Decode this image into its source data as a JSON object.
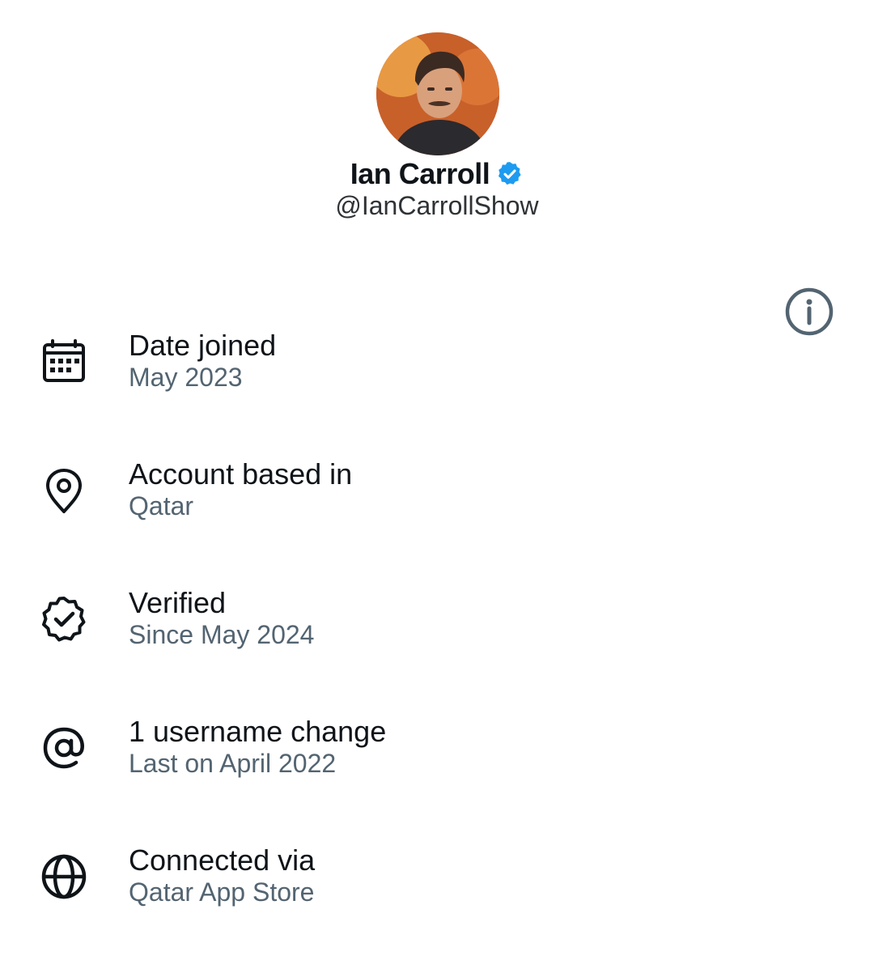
{
  "profile": {
    "display_name": "Ian Carroll",
    "handle": "@IanCarrollShow",
    "verified": true,
    "badge_color": "#1d9bf0"
  },
  "about": {
    "items": [
      {
        "icon": "calendar-icon",
        "title": "Date joined",
        "subtitle": "May 2023"
      },
      {
        "icon": "location-pin-icon",
        "title": "Account based in",
        "subtitle": "Qatar"
      },
      {
        "icon": "verified-badge-outline-icon",
        "title": "Verified",
        "subtitle": "Since May 2024",
        "has_info_button": true
      },
      {
        "icon": "at-sign-icon",
        "title": "1 username change",
        "subtitle": "Last on April 2022"
      },
      {
        "icon": "globe-icon",
        "title": "Connected via",
        "subtitle": "Qatar App Store"
      }
    ]
  },
  "colors": {
    "primary_text": "#0f1419",
    "secondary_text": "#536471",
    "icon_stroke": "#0f1419",
    "info_icon_stroke": "#536471"
  }
}
